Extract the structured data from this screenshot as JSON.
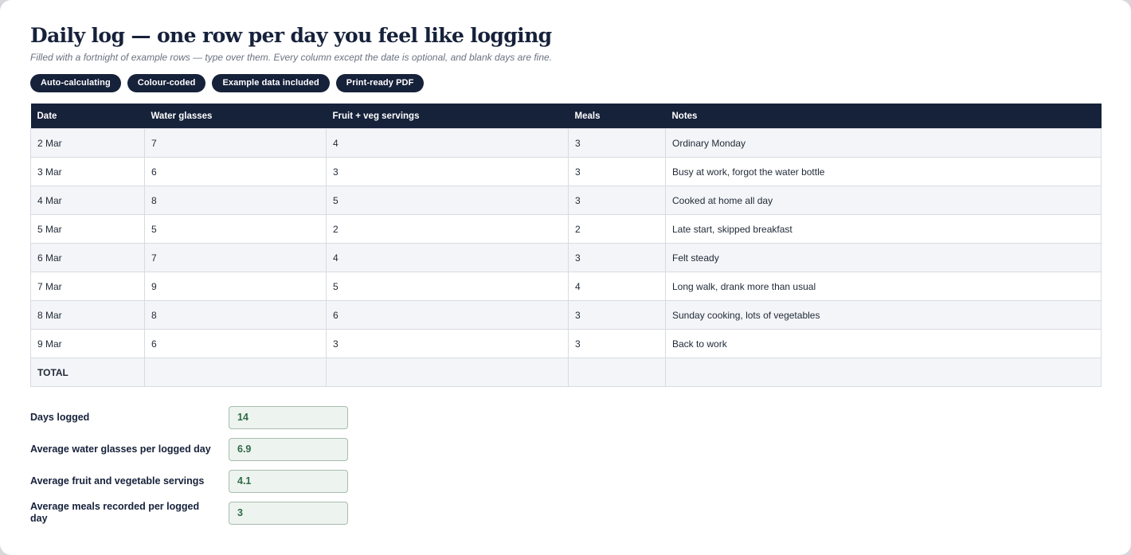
{
  "header": {
    "title": "Daily log — one row per day you feel like logging",
    "subtitle": "Filled with a fortnight of example rows — type over them. Every column except the date is optional, and blank days are fine."
  },
  "badges": [
    "Auto-calculating",
    "Colour-coded",
    "Example data included",
    "Print-ready PDF"
  ],
  "table": {
    "columns": [
      "Date",
      "Water glasses",
      "Fruit + veg servings",
      "Meals",
      "Notes"
    ],
    "rows": [
      [
        "2 Mar",
        "7",
        "4",
        "3",
        "Ordinary Monday"
      ],
      [
        "3 Mar",
        "6",
        "3",
        "3",
        "Busy at work, forgot the water bottle"
      ],
      [
        "4 Mar",
        "8",
        "5",
        "3",
        "Cooked at home all day"
      ],
      [
        "5 Mar",
        "5",
        "2",
        "2",
        "Late start, skipped breakfast"
      ],
      [
        "6 Mar",
        "7",
        "4",
        "3",
        "Felt steady"
      ],
      [
        "7 Mar",
        "9",
        "5",
        "4",
        "Long walk, drank more than usual"
      ],
      [
        "8 Mar",
        "8",
        "6",
        "3",
        "Sunday cooking, lots of vegetables"
      ],
      [
        "9 Mar",
        "6",
        "3",
        "3",
        "Back to work"
      ]
    ],
    "total_label": "TOTAL"
  },
  "summary": [
    {
      "label": "Days logged",
      "value": "14"
    },
    {
      "label": "Average water glasses per logged day",
      "value": "6.9"
    },
    {
      "label": "Average fruit and vegetable servings",
      "value": "4.1"
    },
    {
      "label": "Average meals recorded per logged day",
      "value": "3"
    }
  ]
}
